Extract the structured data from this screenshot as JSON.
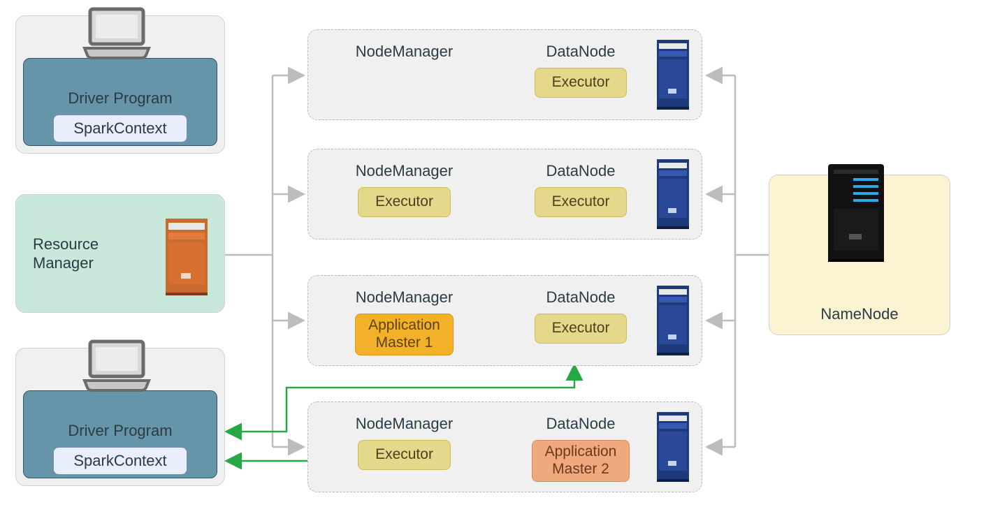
{
  "drivers": [
    {
      "title": "Driver Program",
      "context": "SparkContext"
    },
    {
      "title": "Driver Program",
      "context": "SparkContext"
    }
  ],
  "resource_manager": {
    "line1": "Resource",
    "line2": "Manager"
  },
  "workers": [
    {
      "node_manager": {
        "title": "NodeManager",
        "boxes": []
      },
      "data_node": {
        "title": "DataNode",
        "boxes": [
          {
            "kind": "exec",
            "label": "Executor"
          }
        ]
      }
    },
    {
      "node_manager": {
        "title": "NodeManager",
        "boxes": [
          {
            "kind": "exec",
            "label": "Executor"
          }
        ]
      },
      "data_node": {
        "title": "DataNode",
        "boxes": [
          {
            "kind": "exec",
            "label": "Executor"
          }
        ]
      }
    },
    {
      "node_manager": {
        "title": "NodeManager",
        "boxes": [
          {
            "kind": "am1",
            "label": "Application\nMaster 1"
          }
        ]
      },
      "data_node": {
        "title": "DataNode",
        "boxes": [
          {
            "kind": "exec",
            "label": "Executor"
          }
        ]
      }
    },
    {
      "node_manager": {
        "title": "NodeManager",
        "boxes": [
          {
            "kind": "exec",
            "label": "Executor"
          }
        ]
      },
      "data_node": {
        "title": "DataNode",
        "boxes": [
          {
            "kind": "am2",
            "label": "Application\nMaster 2"
          }
        ]
      }
    }
  ],
  "name_node": {
    "label": "NameNode"
  },
  "icons": {
    "laptop": "laptop-icon",
    "server_orange": "server-orange-icon",
    "server_blue": "server-blue-icon",
    "server_black": "server-black-icon"
  },
  "colors": {
    "panel_gray": "#f0f0f0",
    "driver_blue": "#6694a8",
    "rm_mint": "#c8e8dc",
    "nn_cream": "#fcf3d2",
    "exec_yellow": "#e6d88a",
    "am1_orange": "#f3b029",
    "am2_salmon": "#f0a97c",
    "connector_gray": "#bcbcbc",
    "connector_green": "#28a745"
  }
}
